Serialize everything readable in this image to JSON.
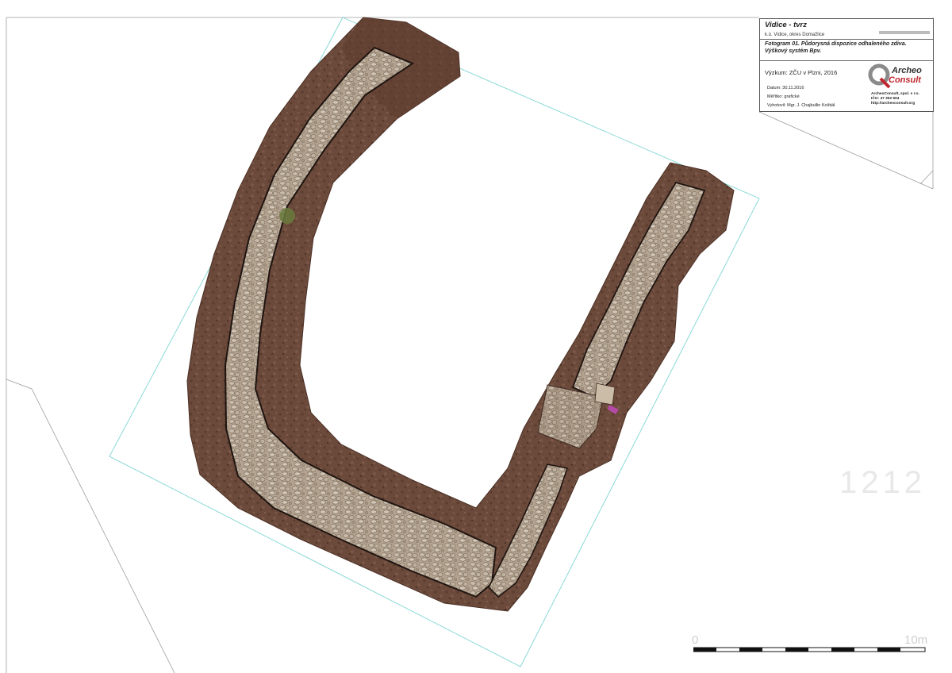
{
  "title_block": {
    "site_title": "Vidice - tvrz",
    "location": "k.ú. Vidice, okres Domažlice",
    "description_line1": "Fotogram 01. Půdorysná dispozice odhaleného zdiva.",
    "description_line2": "Výškový systém Bpv.",
    "research": "Výzkum: ZČU v Plzni, 2016",
    "date": "Datum: 30.11.2016",
    "scale": "Měřítko: grafické",
    "author": "Vyhotovil: Mgr. J. Chajbullin Koštiál",
    "logo_word1": "Archeo",
    "logo_word2": "Consult",
    "company_name": "ArcheoConsult, spol. s r.o.",
    "company_ico": "IČO: 47 352 604",
    "company_web": "http://archeoconsult.org"
  },
  "parcel_number": "1212",
  "scale_bar": {
    "start_label": "0",
    "end_label": "10m"
  },
  "colors": {
    "soil": "#6e4b3a",
    "soil_dark": "#4f3327",
    "masonry": "#b7a896",
    "frame_line": "#7fd6d2",
    "cadastral_line": "#9c9c9c",
    "logo_red": "#c0262d"
  }
}
